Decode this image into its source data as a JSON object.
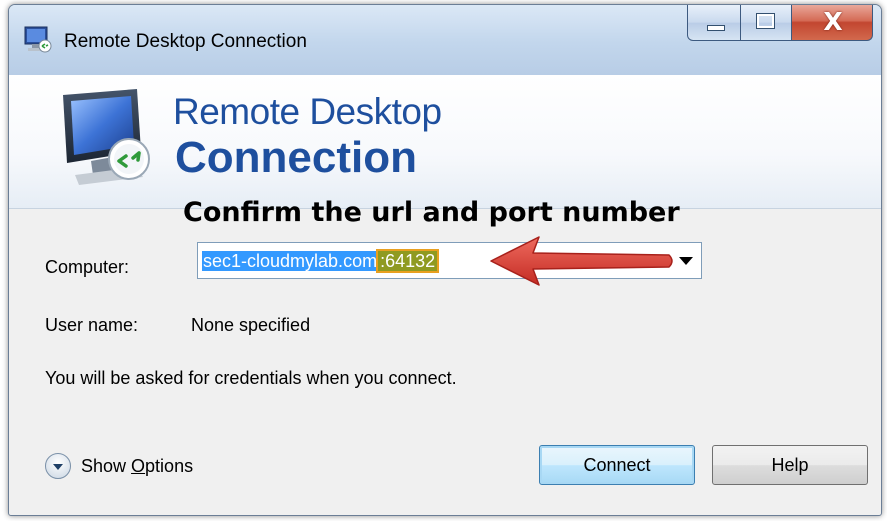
{
  "window": {
    "title": "Remote Desktop Connection",
    "controls": {
      "minimize": "minimize",
      "maximize": "maximize",
      "close": "X"
    }
  },
  "banner": {
    "line1": "Remote Desktop",
    "line2": "Connection"
  },
  "annotation": {
    "text": "Confirm the url and port number",
    "arrow_color": "#d93a32"
  },
  "form": {
    "computer_label": "Computer:",
    "computer_host": "sec1-cloudmylab.com",
    "computer_port": ":64132",
    "username_label": "User name:",
    "username_value": "None specified",
    "credentials_note": "You will be asked for credentials when you connect."
  },
  "footer": {
    "show_options_pre": "Show ",
    "show_options_accel": "O",
    "show_options_post": "ptions",
    "connect_label": "Connect",
    "help_label": "Help"
  },
  "colors": {
    "accent_blue": "#1e4f9e",
    "selection": "#3399ff",
    "port_highlight": "#8f9a21"
  }
}
